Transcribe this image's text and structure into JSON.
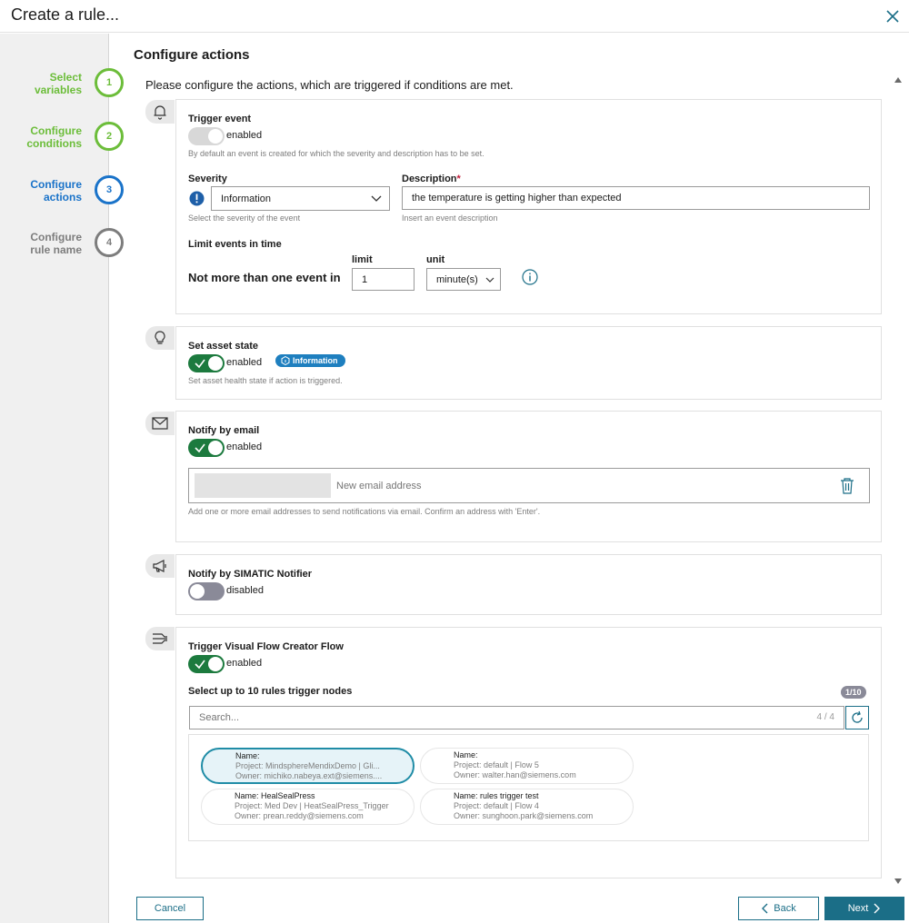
{
  "window": {
    "title": "Create a rule..."
  },
  "steps": [
    {
      "num": "1",
      "label": "Select variables",
      "state": "done"
    },
    {
      "num": "2",
      "label": "Configure conditions",
      "state": "done"
    },
    {
      "num": "3",
      "label": "Configure actions",
      "state": "active"
    },
    {
      "num": "4",
      "label": "Configure rule name",
      "state": "todo"
    }
  ],
  "main": {
    "title": "Configure actions",
    "intro": "Please configure the actions, which are triggered if conditions are met."
  },
  "trigger_event": {
    "title": "Trigger event",
    "toggle_label": "enabled",
    "hint": "By default an event is created for which the severity and description has to be set.",
    "severity_label": "Severity",
    "severity_value": "Information",
    "severity_hint": "Select the severity of the event",
    "description_label": "Description",
    "description_required": "*",
    "description_value": "the temperature is getting higher than expected",
    "description_hint": "Insert an event description",
    "limit_title": "Limit events in time",
    "limit_text": "Not more than one event in",
    "limit_label": "limit",
    "limit_value": "1",
    "unit_label": "unit",
    "unit_value": "minute(s)"
  },
  "asset_state": {
    "title": "Set asset state",
    "toggle_label": "enabled",
    "badge": "Information",
    "hint": "Set asset health state if action is triggered."
  },
  "email": {
    "title": "Notify by email",
    "toggle_label": "enabled",
    "placeholder": "New email address",
    "hint": "Add one or more email addresses to send notifications via email. Confirm an address with 'Enter'."
  },
  "simatic": {
    "title": "Notify by SIMATIC Notifier",
    "toggle_label": "disabled"
  },
  "vfc": {
    "title": "Trigger Visual Flow Creator Flow",
    "toggle_label": "enabled",
    "select_label": "Select up to 10 rules trigger nodes",
    "count_badge": "1/10",
    "search_placeholder": "Search...",
    "search_count": "4 / 4",
    "flows": [
      {
        "name": "Name:",
        "project": "Project: MindsphereMendixDemo | Gli...",
        "owner": "Owner: michiko.nabeya.ext@siemens....",
        "selected": true
      },
      {
        "name": "Name:",
        "project": "Project: default | Flow 5",
        "owner": "Owner: walter.han@siemens.com",
        "selected": false
      },
      {
        "name": "Name:  HealSealPress",
        "project": "Project: Med Dev | HeatSealPress_Trigger",
        "owner": "Owner: prean.reddy@siemens.com",
        "selected": false
      },
      {
        "name": "Name:  rules trigger test",
        "project": "Project: default | Flow 4",
        "owner": "Owner: sunghoon.park@siemens.com",
        "selected": false
      }
    ]
  },
  "footer": {
    "cancel": "Cancel",
    "back": "Back",
    "next": "Next"
  },
  "colors": {
    "accent": "#1b6e87",
    "done": "#6cbd3a",
    "active": "#1a73c9",
    "toggle_on": "#1c7a3e"
  }
}
